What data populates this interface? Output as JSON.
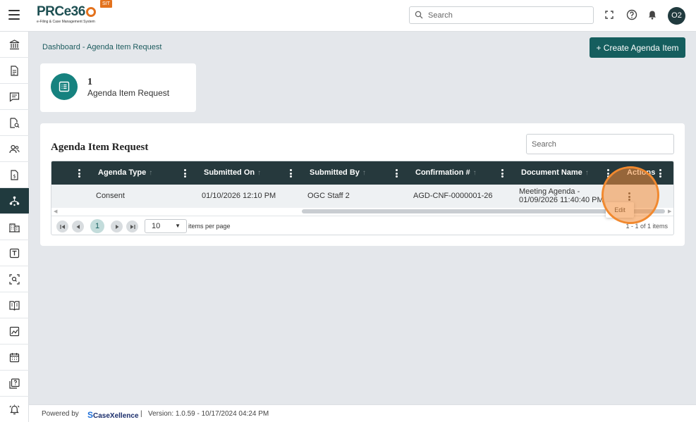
{
  "header": {
    "logo_text": "PRCe36",
    "logo_tagline": "e-Filing & Case Management System",
    "env_badge": "SIT",
    "search_placeholder": "Search",
    "avatar_initials": "O2"
  },
  "sidebar": {
    "items": [
      {
        "icon": "bank-icon"
      },
      {
        "icon": "document-icon"
      },
      {
        "icon": "chat-icon"
      },
      {
        "icon": "document-search-icon"
      },
      {
        "icon": "users-icon"
      },
      {
        "icon": "dollar-document-icon"
      },
      {
        "icon": "workflow-icon",
        "active": true
      },
      {
        "icon": "building-icon"
      },
      {
        "icon": "text-box-icon"
      },
      {
        "icon": "scan-search-icon"
      },
      {
        "icon": "book-icon"
      },
      {
        "icon": "chart-icon"
      },
      {
        "icon": "calendar-icon"
      },
      {
        "icon": "help-pages-icon"
      },
      {
        "icon": "alarm-icon"
      }
    ]
  },
  "breadcrumb": "Dashboard - Agenda Item Request",
  "create_button": "+ Create Agenda Item",
  "stat_card": {
    "count": "1",
    "label": "Agenda Item Request"
  },
  "panel": {
    "title": "Agenda Item Request",
    "search_placeholder": "Search"
  },
  "grid": {
    "columns": [
      "Agenda Type",
      "Submitted On",
      "Submitted By",
      "Confirmation #",
      "Document Name",
      "Actions"
    ],
    "sort_arrow": "↑",
    "rows": [
      {
        "agenda_type": "Consent",
        "submitted_on": "01/10/2026 12:10 PM",
        "submitted_by": "OGC Staff 2",
        "confirmation": "AGD-CNF-0000001-26",
        "document_name_line1": "Meeting Agenda -",
        "document_name_line2": "01/09/2026 11:40:40 PM"
      }
    ],
    "pager": {
      "current_page": "1",
      "page_size": "10",
      "items_per_page_label": "items per page",
      "info": "1 - 1 of 1 items"
    }
  },
  "context_menu": {
    "edit_label": "Edit"
  },
  "footer": {
    "powered_by": "Powered by",
    "brand": "CaseXellence",
    "separator": "|",
    "version": "Version: 1.0.59 - 10/17/2024 04:24 PM"
  },
  "colors": {
    "primary": "#155e5e",
    "header_dark": "#26393d",
    "accent_orange": "#f1892f"
  }
}
